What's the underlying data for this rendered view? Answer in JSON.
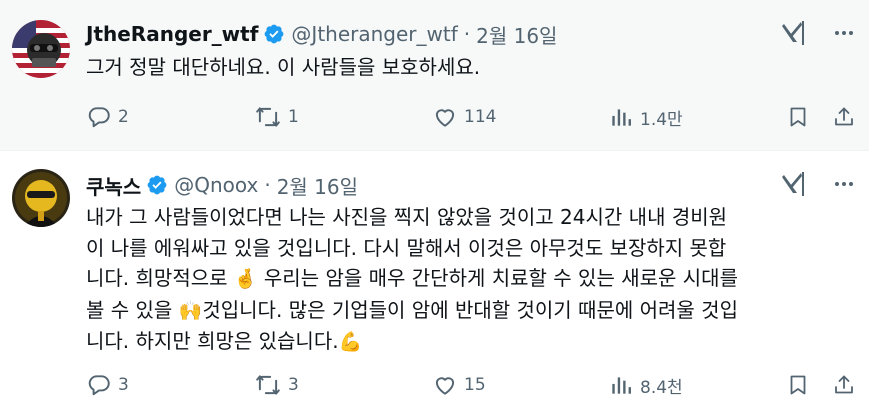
{
  "tweets": [
    {
      "name": "JtheRanger_wtf",
      "handle": "@Jtheranger_wtf",
      "separator": "·",
      "date": "2월 16일",
      "lines": [
        "그거 정말 대단하네요. 이 사람들을 보호하세요."
      ],
      "replies": "2",
      "retweets": "1",
      "likes": "114",
      "views": "1.4만"
    },
    {
      "name": "쿠녹스",
      "handle": "@Qnoox",
      "separator": "·",
      "date": "2월 16일",
      "lines": [
        "내가 그 사람들이었다면 나는 사진을 찍지 않았을 것이고 24시간 내내 경비원",
        "이 나를 에워싸고 있을 것입니다. 다시 말해서 이것은 아무것도 보장하지 못합",
        "니다. 희망적으로",
        "우리는 암을 매우 간단하게 치료할 수 있는 새로운 시대를",
        "볼 수 있을",
        "것입니다. 많은 기업들이 암에 반대할 것이기 때문에 어려울 것입",
        "니다. 하지만 희망은 있습니다."
      ],
      "emojis": {
        "fingers_crossed": "🤞",
        "raising_hands": "🙌",
        "flexed_biceps": "💪"
      },
      "replies": "3",
      "retweets": "3",
      "likes": "15",
      "views": "8.4천"
    }
  ],
  "colors": {
    "verified_badge": "#1d9bf0",
    "secondary_text": "#536471",
    "highlight_bg": "#f7f9f9"
  },
  "icons": {
    "verified": "verified-badge-icon",
    "grok": "grok-icon",
    "more": "more-icon",
    "reply": "reply-icon",
    "retweet": "retweet-icon",
    "like": "like-icon",
    "views": "views-icon",
    "bookmark": "bookmark-icon",
    "share": "share-icon"
  }
}
